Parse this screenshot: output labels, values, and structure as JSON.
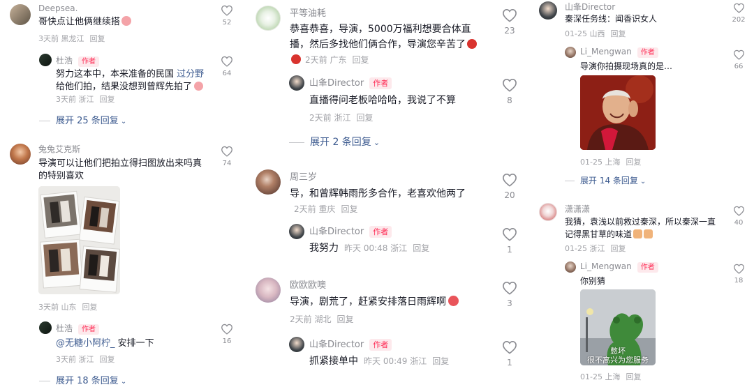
{
  "colors": {
    "text": "#161823",
    "muted": "#8a8b91",
    "link": "#3c5a8f",
    "author_tag_bg": "#fde9ec",
    "author_tag_text": "#fe2c55"
  },
  "author_tag": "作者",
  "reply_label": "回复",
  "col1": {
    "c1": {
      "name": "Deepsea.",
      "text": "哥快点让他俩继续搭",
      "time": "3天前",
      "location": "黑龙江",
      "likes": "52"
    },
    "r1": {
      "name": "杜浩",
      "text_a": "努力这本中，本来准备的民国 ",
      "highlight": "过分野",
      "text_b": " 给他们拍，结果没想到曾辉先拍了",
      "time": "3天前",
      "location": "浙江",
      "likes": "64"
    },
    "e1": "展开 25 条回复",
    "c2": {
      "name": "兔兔艾克斯",
      "text": "导演可以让他们把拍立得扫图放出来吗真的特别喜欢",
      "time": "3天前",
      "location": "山东",
      "likes": "74"
    },
    "r2": {
      "name": "杜浩",
      "mention": "@无糖小阿柠_",
      "text": " 安排一下",
      "time": "3天前",
      "location": "浙江",
      "likes": "16"
    },
    "e2": "展开 18 条回复"
  },
  "col2": {
    "c1": {
      "name": "平等油耗",
      "text": "恭喜恭喜，导演，5000万福利想要合体直播，然后多找他们俩合作，导演您辛苦了",
      "time": "2天前",
      "location": "广东",
      "likes": "23"
    },
    "r1": {
      "name": "山夆Director",
      "text": "直播得问老板哈哈哈，我说了不算",
      "time": "2天前",
      "location": "浙江",
      "likes": "8"
    },
    "e1": "展开 2 条回复",
    "c2": {
      "name": "周三岁",
      "text": "导，和曾辉韩雨彤多合作，老喜欢他两了",
      "time": "2天前",
      "location": "重庆",
      "likes": "20"
    },
    "r2": {
      "name": "山夆Director",
      "text": "我努力",
      "time": "昨天 00:48",
      "location": "浙江",
      "likes": "1"
    },
    "c3": {
      "name": "欧欧欧噢",
      "text": "导演，剧荒了，赶紧安排落日雨辉啊",
      "time": "2天前",
      "location": "湖北",
      "likes": "3"
    },
    "r3": {
      "name": "山夆Director",
      "text": "抓紧接单中",
      "time": "昨天 00:49",
      "location": "浙江",
      "likes": "1"
    }
  },
  "col3": {
    "c1": {
      "name": "山夆Director",
      "text": "秦深任务线：闻香识女人",
      "time": "01-25",
      "location": "山西",
      "likes": "202"
    },
    "r1": {
      "name": "Li_Mengwan",
      "text": "导演你拍摄现场真的是…",
      "time": "01-25",
      "location": "上海",
      "likes": "66"
    },
    "e1": "展开 14 条回复",
    "c2": {
      "name": "潇潇潇",
      "text": "我猜，袁浅以前救过秦深，所以秦深一直记得黑甘草的味道",
      "time": "01-25",
      "location": "浙江",
      "likes": "40"
    },
    "r2": {
      "name": "Li_Mengwan",
      "text": "你别猜",
      "time": "01-25",
      "location": "上海",
      "likes": "18"
    },
    "meme_caption_1": "憋坏",
    "meme_caption_2": "很不高兴为您服务"
  }
}
